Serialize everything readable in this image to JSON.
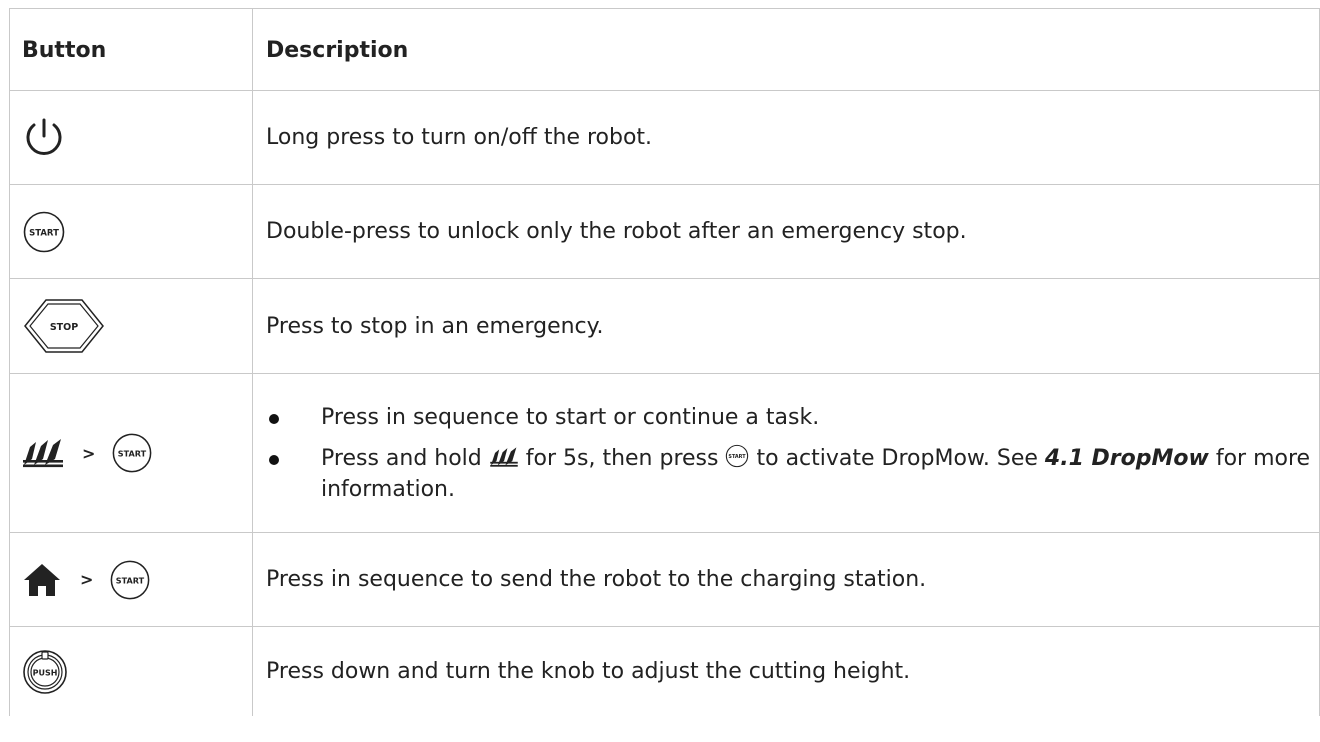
{
  "table": {
    "headers": {
      "button": "Button",
      "description": "Description"
    },
    "rows": [
      {
        "icons": [
          "power-icon"
        ],
        "description": "Long press to turn on/off the robot."
      },
      {
        "icons": [
          "start-button-icon"
        ],
        "button_text": "START",
        "description": "Double-press to unlock only the robot after an emergency stop."
      },
      {
        "icons": [
          "stop-button-icon"
        ],
        "button_text": "STOP",
        "description": "Press to stop in an emergency."
      },
      {
        "icons": [
          "mow-icon",
          "start-button-icon"
        ],
        "separator": ">",
        "button_text": "START",
        "bullets": {
          "first": "Press in sequence to start or continue a task.",
          "second_part1": "Press and hold",
          "second_part2": "for 5s, then press",
          "second_part3": "to activate DropMow. See",
          "second_link": "4.1 DropMow",
          "second_part4": "for more information."
        }
      },
      {
        "icons": [
          "home-icon",
          "start-button-icon"
        ],
        "separator": ">",
        "button_text": "START",
        "description": "Press in sequence to send the robot to the charging station."
      },
      {
        "icons": [
          "push-knob-icon"
        ],
        "button_text": "PUSH",
        "description": "Press down and turn the knob to adjust the cutting height."
      }
    ]
  }
}
